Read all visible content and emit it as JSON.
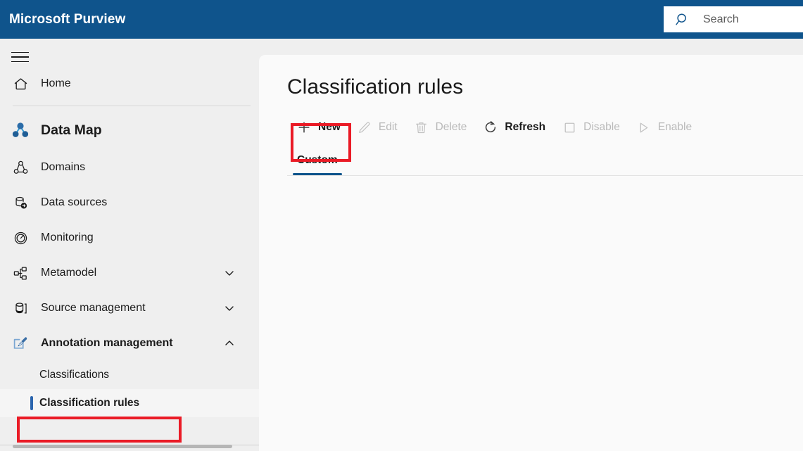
{
  "header": {
    "brand": "Microsoft Purview",
    "search": {
      "placeholder": "Search",
      "value": "",
      "icon": "search-icon"
    },
    "background_color": "#0f548c"
  },
  "sidebar": {
    "menu_icon": "hamburger-icon",
    "home": {
      "label": "Home",
      "icon": "home-icon"
    },
    "section": {
      "label": "Data Map",
      "icon": "data-map-icon"
    },
    "items": [
      {
        "label": "Domains",
        "icon": "domains-icon",
        "expandable": false
      },
      {
        "label": "Data sources",
        "icon": "data-sources-icon",
        "expandable": false
      },
      {
        "label": "Monitoring",
        "icon": "monitoring-icon",
        "expandable": false
      },
      {
        "label": "Metamodel",
        "icon": "metamodel-icon",
        "expandable": true,
        "expanded": false,
        "chevron": "chevron-down-icon"
      },
      {
        "label": "Source management",
        "icon": "source-management-icon",
        "expandable": true,
        "expanded": false,
        "chevron": "chevron-down-icon"
      },
      {
        "label": "Annotation management",
        "icon": "annotation-management-icon",
        "expandable": true,
        "expanded": true,
        "chevron": "chevron-up-icon"
      }
    ],
    "sub_items": [
      {
        "label": "Classifications",
        "selected": false
      },
      {
        "label": "Classification rules",
        "selected": true
      }
    ],
    "selected_accent_color": "#2b65ae"
  },
  "main": {
    "title": "Classification rules",
    "toolbar": [
      {
        "label": "New",
        "icon": "plus-icon",
        "disabled": false,
        "highlighted": true
      },
      {
        "label": "Edit",
        "icon": "pencil-icon",
        "disabled": true,
        "highlighted": false
      },
      {
        "label": "Delete",
        "icon": "trash-icon",
        "disabled": true,
        "highlighted": false
      },
      {
        "label": "Refresh",
        "icon": "refresh-icon",
        "disabled": false,
        "highlighted": false
      },
      {
        "label": "Disable",
        "icon": "square-icon",
        "disabled": true,
        "highlighted": false
      },
      {
        "label": "Enable",
        "icon": "play-icon",
        "disabled": true,
        "highlighted": false
      }
    ],
    "tabs": [
      {
        "label": "Custom",
        "active": true
      }
    ],
    "tab_accent_color": "#0f548c"
  },
  "annotations": {
    "highlight_color": "#ea1b26",
    "boxes": [
      {
        "name": "new-button-highlight"
      },
      {
        "name": "classification-rules-nav-highlight"
      }
    ]
  }
}
